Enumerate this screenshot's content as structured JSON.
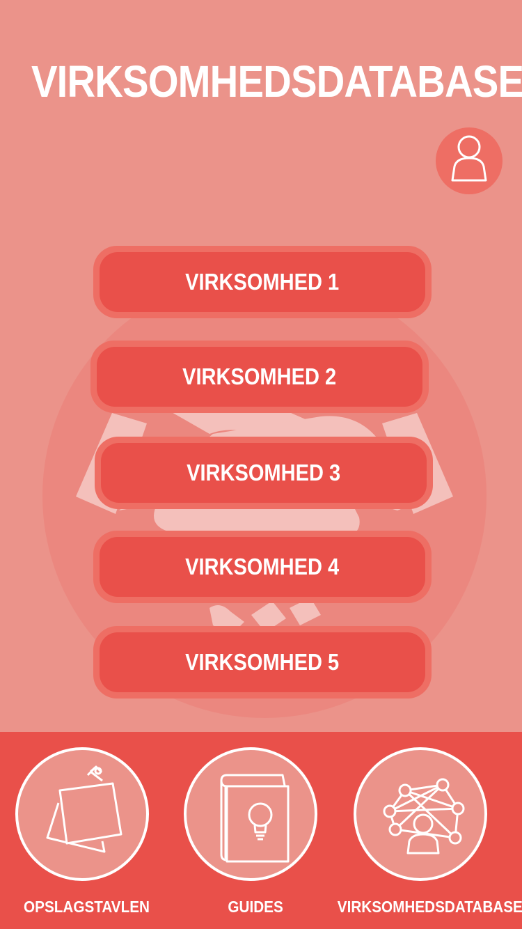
{
  "header": {
    "title": "VIRKSOMHEDSDATABASE",
    "profile_icon": "user-icon"
  },
  "companies": [
    {
      "label": "VIRKSOMHED 1"
    },
    {
      "label": "VIRKSOMHED 2"
    },
    {
      "label": "VIRKSOMHED 3"
    },
    {
      "label": "VIRKSOMHED 4"
    },
    {
      "label": "VIRKSOMHED 5"
    }
  ],
  "bottom_nav": [
    {
      "label": "OPSLAGSTAVLEN",
      "icon": "sticky-notes-icon"
    },
    {
      "label": "GUIDES",
      "icon": "book-lightbulb-icon"
    },
    {
      "label": "VIRKSOMHEDSDATABASE",
      "icon": "network-icon"
    }
  ],
  "colors": {
    "background": "#EB938A",
    "button": "#E9504A",
    "button_border": "#EE6E64",
    "bottom_bar": "#E9504A",
    "text": "#FFFFFF"
  }
}
